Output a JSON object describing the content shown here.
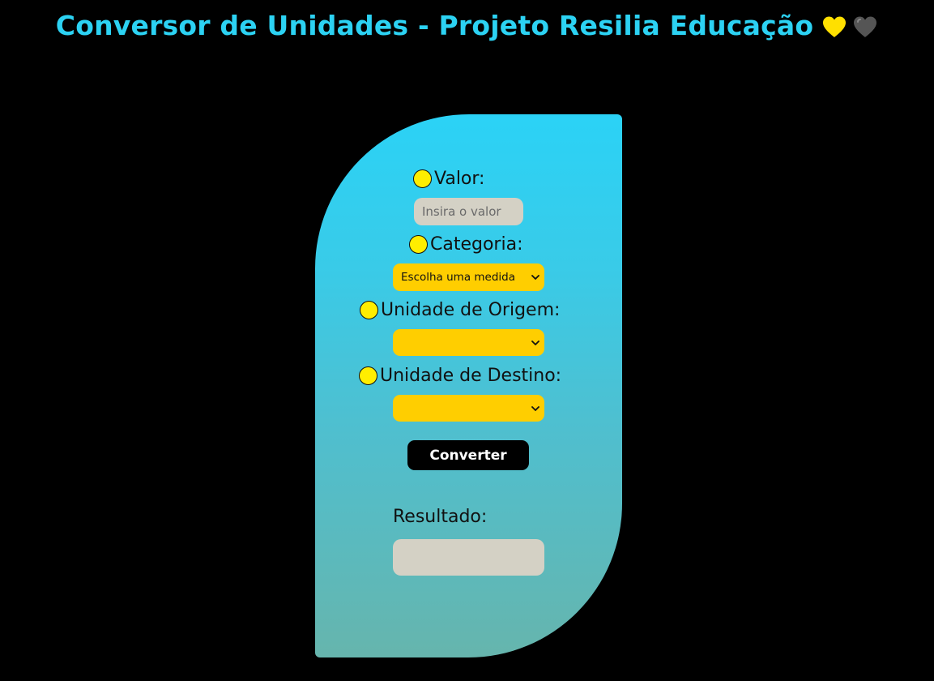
{
  "header": {
    "title": "Conversor de Unidades - Projeto Resilia Educação",
    "hearts": [
      "yellow-heart-icon",
      "black-heart-icon"
    ]
  },
  "form": {
    "valor": {
      "label": "Valor:",
      "placeholder": "Insira o valor",
      "value": ""
    },
    "categoria": {
      "label": "Categoria:",
      "selected": "Escolha uma medida"
    },
    "origem": {
      "label": "Unidade de Origem:",
      "selected": ""
    },
    "destino": {
      "label": "Unidade de Destino:",
      "selected": ""
    },
    "convert_label": "Converter",
    "result": {
      "label": "Resultado:",
      "value": ""
    }
  },
  "colors": {
    "background": "#000000",
    "title": "#2cd2f3",
    "card_top": "#2bd2f6",
    "card_bottom": "#66b5ad",
    "select": "#ffce00",
    "dot": "#ffee00",
    "input": "#d4d1c5",
    "heart_yellow": "#ffe000",
    "heart_dark": "#555555"
  }
}
